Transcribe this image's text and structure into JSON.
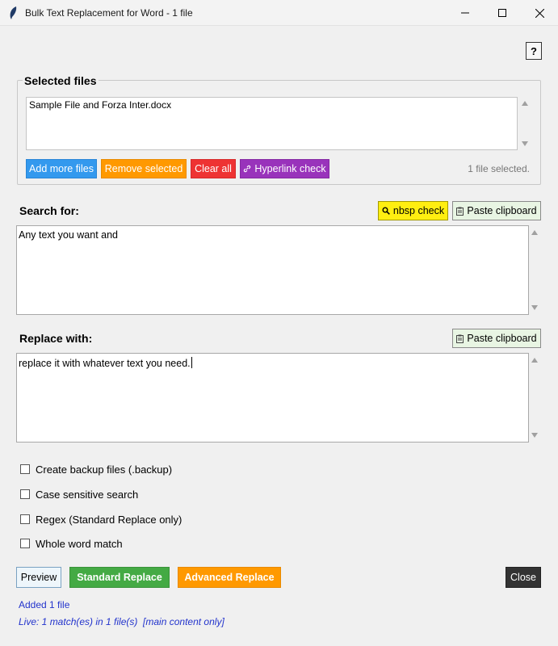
{
  "window": {
    "title": "Bulk Text Replacement for Word - 1 file"
  },
  "help": {
    "label": "?"
  },
  "selected_files": {
    "label": "Selected files",
    "items": [
      "Sample File and Forza Inter.docx"
    ],
    "buttons": {
      "add": "Add more files",
      "remove": "Remove selected",
      "clear": "Clear all",
      "hyperlink": "Hyperlink check"
    },
    "count_text": "1 file selected."
  },
  "search": {
    "label": "Search for:",
    "value": "Any text you want and",
    "nbsp_label": "nbsp check",
    "paste_label": "Paste clipboard"
  },
  "replace": {
    "label": "Replace with:",
    "value": "replace it with whatever text you need.",
    "paste_label": "Paste clipboard"
  },
  "options": [
    {
      "label": "Create backup files (.backup)",
      "checked": false
    },
    {
      "label": "Case sensitive search",
      "checked": false
    },
    {
      "label": "Regex (Standard Replace only)",
      "checked": false
    },
    {
      "label": "Whole word match",
      "checked": false
    }
  ],
  "actions": {
    "preview": "Preview",
    "standard": "Standard Replace",
    "advanced": "Advanced Replace",
    "close": "Close"
  },
  "status": {
    "line1": "Added 1 file",
    "line2": "Live: 1 match(es) in 1 file(s)  [main content only]"
  },
  "colors": {
    "blue": "#3399ee",
    "orange": "#ff9900",
    "red": "#ee3333",
    "purple": "#9933bb",
    "yellow": "#ffee11",
    "green": "#44aa44",
    "dark": "#333333",
    "status_text": "#2233cc"
  }
}
